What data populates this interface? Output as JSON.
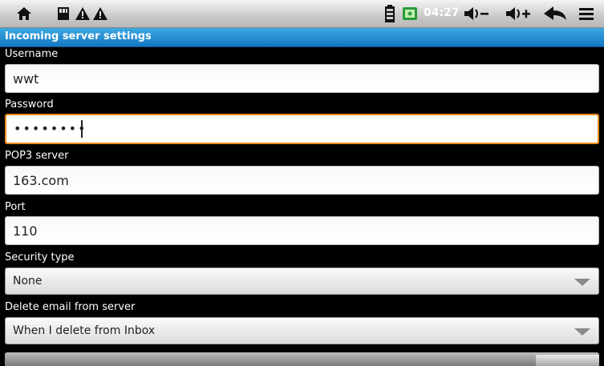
{
  "statusbar": {
    "icons": [
      "home-icon",
      "sd-card-icon",
      "warning-icon",
      "warning-icon",
      "battery-icon",
      "usb-debug-icon",
      "volume-down-icon",
      "volume-up-icon",
      "back-icon",
      "menu-icon"
    ],
    "time": "04:27"
  },
  "title": "Incoming server settings",
  "fields": {
    "username": {
      "label": "Username",
      "value": "wwt"
    },
    "password": {
      "label": "Password",
      "value": "••••••••"
    },
    "pop3": {
      "label": "POP3 server",
      "value": "163.com"
    },
    "port": {
      "label": "Port",
      "value": "110"
    }
  },
  "dropdowns": {
    "security": {
      "label": "Security type",
      "value": "None"
    },
    "delete": {
      "label": "Delete email from server",
      "value": "When I delete from Inbox"
    }
  }
}
